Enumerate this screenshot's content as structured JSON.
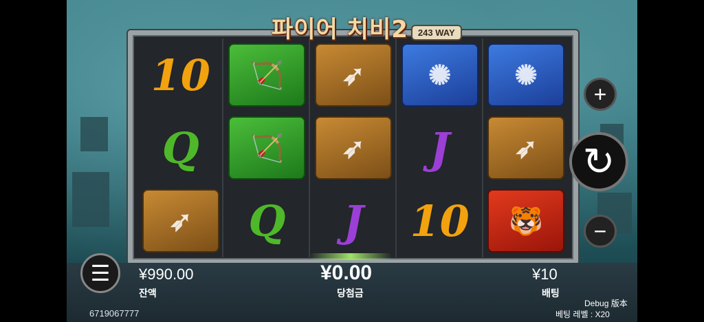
{
  "title": {
    "main": "파이어 치비2",
    "badge": "243 WAY"
  },
  "reels": [
    [
      {
        "kind": "ten",
        "text": "10"
      },
      {
        "kind": "bow",
        "text": ""
      },
      {
        "kind": "arrows",
        "text": ""
      },
      {
        "kind": "fan",
        "text": ""
      },
      {
        "kind": "fan",
        "text": ""
      }
    ],
    [
      {
        "kind": "q",
        "text": "Q"
      },
      {
        "kind": "bow",
        "text": ""
      },
      {
        "kind": "arrows",
        "text": ""
      },
      {
        "kind": "j",
        "text": "J"
      },
      {
        "kind": "arrows",
        "text": ""
      }
    ],
    [
      {
        "kind": "arrows",
        "text": ""
      },
      {
        "kind": "q",
        "text": "Q"
      },
      {
        "kind": "j",
        "text": "J"
      },
      {
        "kind": "ten",
        "text": "10"
      },
      {
        "kind": "tiger",
        "text": ""
      }
    ]
  ],
  "controls": {
    "plus": "+",
    "minus": "−",
    "spin": "↻",
    "menu": "☰"
  },
  "footer": {
    "balance_value": "¥990.00",
    "balance_label": "잔액",
    "win_value": "¥0.00",
    "win_label": "당첨금",
    "bet_value": "¥10",
    "bet_label": "배팅",
    "session_id": "6719067777",
    "debug": "Debug 版本",
    "bet_level": "베팅 레벨 : X20"
  },
  "icons": {
    "bow": "bow-quiver-icon",
    "arrows": "straw-boat-arrows-icon",
    "fan": "feather-fan-icon",
    "tiger": "golden-tiger-icon"
  }
}
